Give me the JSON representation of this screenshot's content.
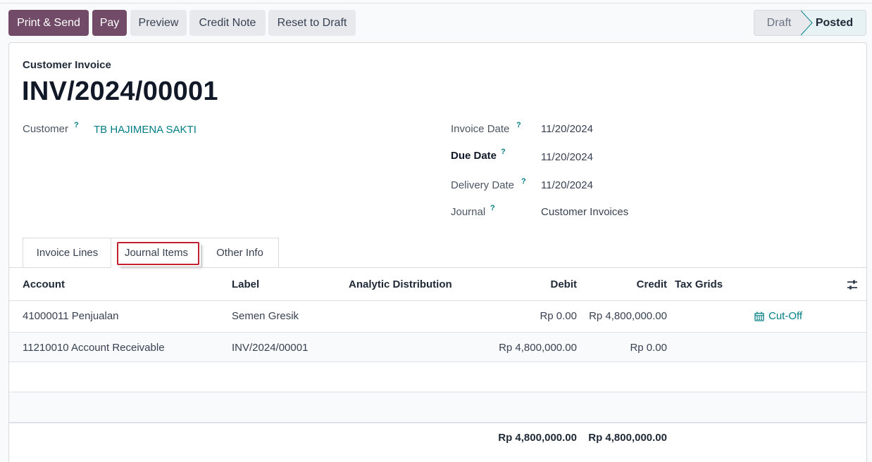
{
  "control": {
    "print_send": "Print & Send",
    "pay": "Pay",
    "preview": "Preview",
    "credit_note": "Credit Note",
    "reset_to_draft": "Reset to Draft"
  },
  "status": {
    "stages": [
      "Draft",
      "Posted"
    ],
    "current": "Posted"
  },
  "invoice": {
    "type": "Customer Invoice",
    "number": "INV/2024/00001",
    "customer_label": "Customer",
    "customer": "TB HAJIMENA SAKTI",
    "invoice_date_label": "Invoice Date",
    "invoice_date": "11/20/2024",
    "due_date_label": "Due Date",
    "due_date": "11/20/2024",
    "delivery_date_label": "Delivery Date",
    "delivery_date": "11/20/2024",
    "journal_label": "Journal",
    "journal": "Customer Invoices",
    "help_mark": "?"
  },
  "tabs": [
    {
      "label": "Invoice Lines"
    },
    {
      "label": "Journal Items",
      "active": true
    },
    {
      "label": "Other Info"
    }
  ],
  "journal_items": {
    "columns": [
      "Account",
      "Label",
      "Analytic Distribution",
      "Debit",
      "Credit",
      "Tax Grids"
    ],
    "rows": [
      {
        "account": "41000011 Penjualan",
        "label": "Semen Gresik",
        "debit": "Rp 0.00",
        "credit": "Rp 4,800,000.00",
        "action": "Cut-Off"
      },
      {
        "account": "11210010 Account Receivable",
        "label": "INV/2024/00001",
        "debit": "Rp 4,800,000.00",
        "credit": "Rp 0.00"
      }
    ],
    "total_debit": "Rp 4,800,000.00",
    "total_credit": "Rp 4,800,000.00"
  },
  "colors": {
    "primary": "#714b67",
    "link": "#017e84",
    "highlight": "#c0212f"
  },
  "icons": {
    "cutoff": "calendar-icon",
    "optional_columns": "sliders-icon"
  }
}
